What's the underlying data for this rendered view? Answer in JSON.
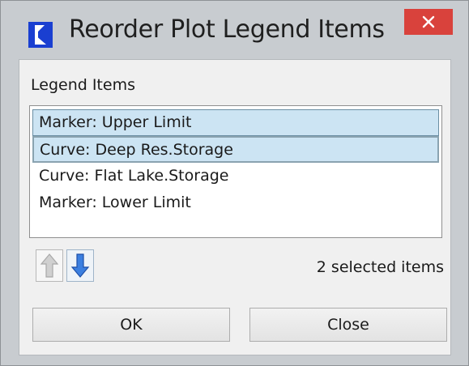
{
  "window": {
    "title": "Reorder Plot Legend Items",
    "close_glyph": "×",
    "app_icon": "riverware-r-icon"
  },
  "legend": {
    "label": "Legend Items",
    "items": [
      {
        "label": "Marker: Upper Limit",
        "selected": true
      },
      {
        "label": "Curve: Deep Res.Storage",
        "selected": true
      },
      {
        "label": "Curve: Flat Lake.Storage",
        "selected": false
      },
      {
        "label": "Marker: Lower Limit",
        "selected": false
      }
    ]
  },
  "controls": {
    "move_up_icon": "arrow-up-icon",
    "move_down_icon": "arrow-down-icon",
    "move_up_enabled": false,
    "move_down_enabled": true,
    "status": "2 selected items"
  },
  "buttons": {
    "ok": "OK",
    "close": "Close"
  },
  "colors": {
    "close_button": "#d9423c",
    "selection": "#cce4f3",
    "arrow_enabled": "#2f6fd6",
    "arrow_disabled": "#bdbdbd"
  }
}
